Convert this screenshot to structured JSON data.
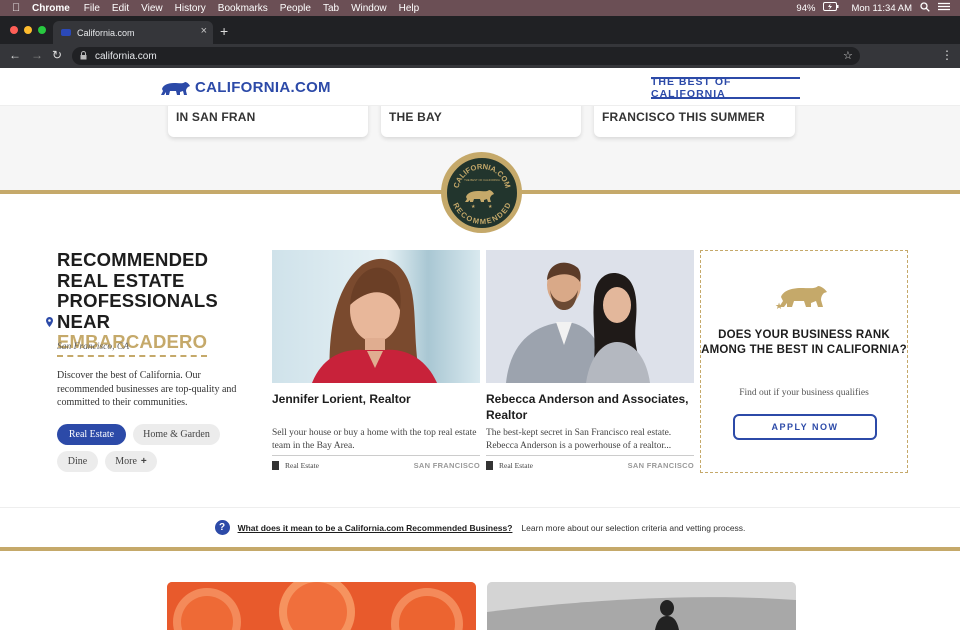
{
  "menubar": {
    "app": "Chrome",
    "items": [
      "File",
      "Edit",
      "View",
      "History",
      "Bookmarks",
      "People",
      "Tab",
      "Window",
      "Help"
    ],
    "battery": "94%",
    "clock": "Mon 11:34 AM"
  },
  "browser": {
    "tab_title": "California.com",
    "url": "california.com"
  },
  "site": {
    "logo_text": "CALIFORNIA.COM",
    "tagline": "THE BEST OF CALIFORNIA"
  },
  "top_cards": [
    {
      "title": "IN SAN FRAN"
    },
    {
      "title": "THE BAY"
    },
    {
      "title": "FRANCISCO THIS SUMMER"
    }
  ],
  "seal": {
    "top_text": "CALIFORNIA.COM",
    "small_text": "THE BEST OF CALIFORNIA",
    "bottom_text": "RECOMMENDED"
  },
  "section": {
    "heading_line1": "RECOMMENDED",
    "heading_line2": "REAL ESTATE",
    "heading_line3": "PROFESSIONALS NEAR",
    "location": "EMBARCADERO",
    "city": "San Francisco, CA",
    "description": "Discover the best of California. Our recommended businesses are top-quality and committed to their communities.",
    "filters": [
      "Real Estate",
      "Home & Garden",
      "Dine",
      "More"
    ]
  },
  "listings": [
    {
      "name": "Jennifer Lorient, Realtor",
      "blurb": "Sell your house or buy a home with the top real estate team in the Bay Area.",
      "category": "Real Estate",
      "city": "SAN FRANCISCO"
    },
    {
      "name": "Rebecca Anderson and Associates, Realtor",
      "blurb": "The best-kept secret in San Francisco real estate. Rebecca Anderson is a powerhouse of a realtor...",
      "category": "Real Estate",
      "city": "SAN FRANCISCO"
    }
  ],
  "cta": {
    "heading": "DOES YOUR BUSINESS RANK AMONG THE BEST IN CALIFORNIA?",
    "sub": "Find out if your business qualifies",
    "button": "APPLY NOW"
  },
  "info": {
    "link": "What does it mean to be a California.com Recommended Business?",
    "text": "Learn more about our selection criteria and vetting process."
  },
  "colors": {
    "brand_blue": "#2c4aa8",
    "gold": "#c5a96a",
    "seal_green": "#22352d"
  }
}
